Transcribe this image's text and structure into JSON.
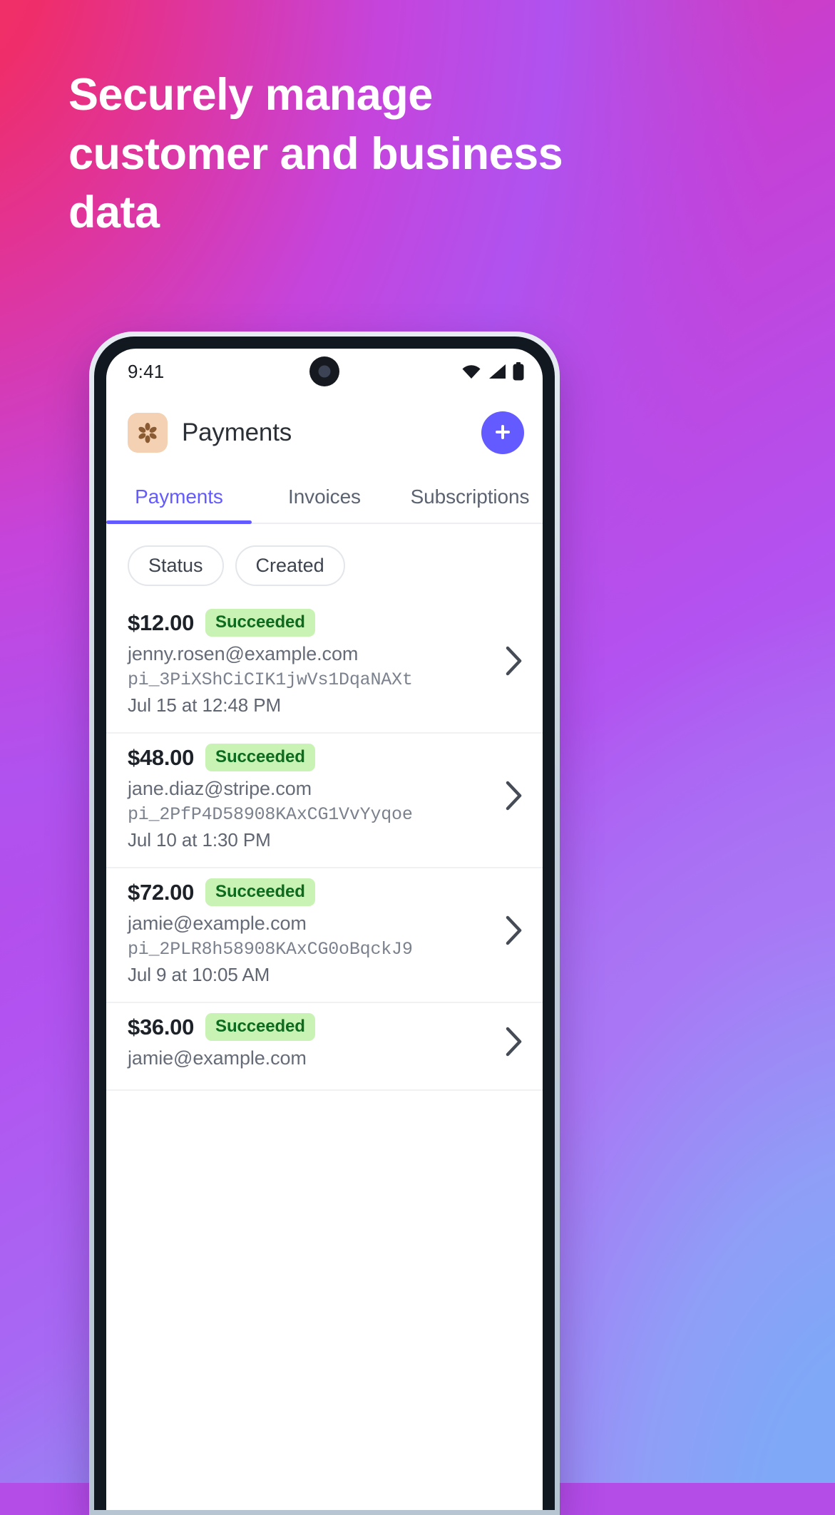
{
  "headline": "Securely manage customer and business data",
  "colors": {
    "brand_purple": "#635bff",
    "badge_bg": "#c9f3b4",
    "badge_text": "#0c6b1f",
    "gradient_start": "#f5335f",
    "gradient_mid": "#b352f0",
    "gradient_end": "#7eaaf8",
    "avatar_bg": "#f3d1b2"
  },
  "status_bar": {
    "time": "9:41",
    "icons": [
      "wifi-icon",
      "cellular-signal-icon",
      "battery-icon"
    ]
  },
  "app_header": {
    "avatar_icon": "stripe-account-flower-icon",
    "title": "Payments",
    "add_button_icon": "plus-icon",
    "add_button_label": "+"
  },
  "tabs": [
    {
      "label": "Payments",
      "active": true
    },
    {
      "label": "Invoices",
      "active": false
    },
    {
      "label": "Subscriptions",
      "active": false
    }
  ],
  "filters": [
    {
      "label": "Status"
    },
    {
      "label": "Created"
    }
  ],
  "payments": [
    {
      "amount": "$12.00",
      "status": "Succeeded",
      "email": "jenny.rosen@example.com",
      "id": "pi_3PiXShCiCIK1jwVs1DqaNAXt",
      "date": "Jul 15 at 12:48 PM"
    },
    {
      "amount": "$48.00",
      "status": "Succeeded",
      "email": "jane.diaz@stripe.com",
      "id": "pi_2PfP4D58908KAxCG1VvYyqoe",
      "date": "Jul 10 at 1:30 PM"
    },
    {
      "amount": "$72.00",
      "status": "Succeeded",
      "email": "jamie@example.com",
      "id": "pi_2PLR8h58908KAxCG0oBqckJ9",
      "date": "Jul 9 at 10:05 AM"
    },
    {
      "amount": "$36.00",
      "status": "Succeeded",
      "email": "jamie@example.com",
      "id": "",
      "date": ""
    }
  ]
}
